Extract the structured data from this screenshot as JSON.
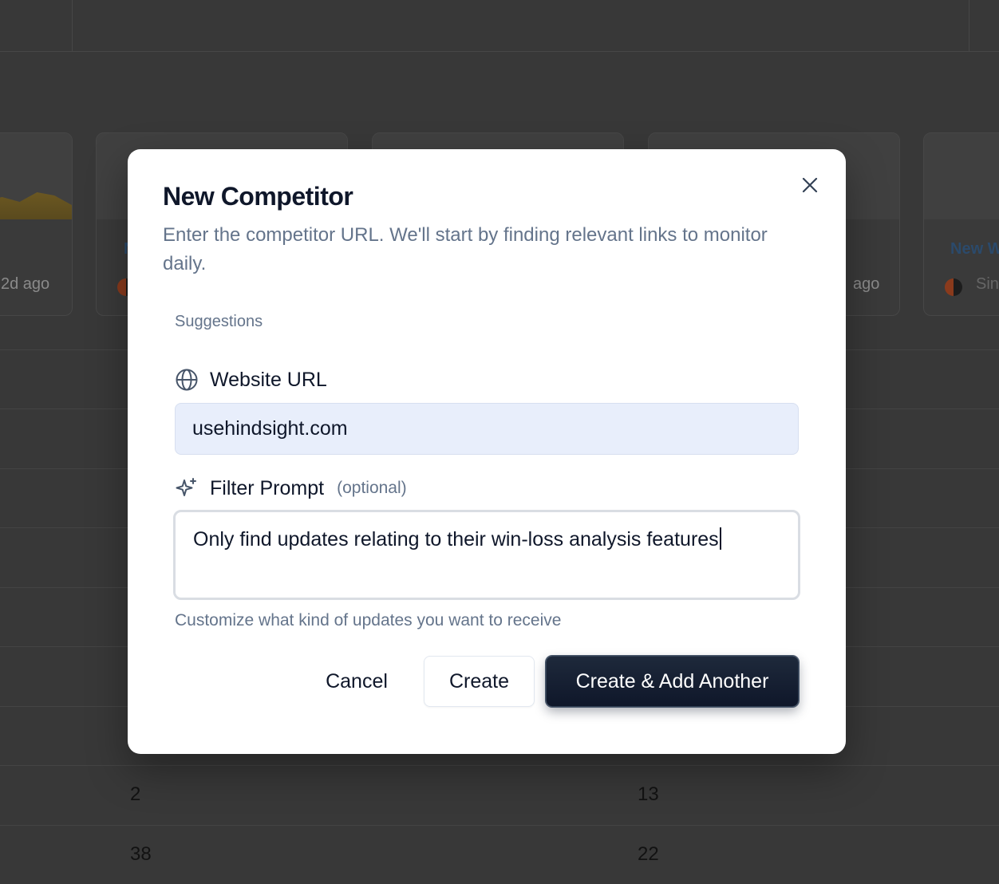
{
  "background": {
    "cards": [
      {
        "time": "2d ago",
        "new_label": "",
        "source": ""
      },
      {
        "time": "",
        "new_label": "N",
        "source": ""
      },
      {
        "time": "",
        "new_label": "",
        "source": ""
      },
      {
        "time": "ago",
        "new_label": "",
        "source": ""
      },
      {
        "time": "",
        "new_label": "New W",
        "source": "Sin"
      }
    ],
    "table_rows": [
      {
        "col1": "2",
        "col2": "13"
      },
      {
        "col1": "38",
        "col2": "22"
      }
    ]
  },
  "modal": {
    "title": "New Competitor",
    "description": "Enter the competitor URL. We'll start by finding relevant links to monitor daily.",
    "suggestions_label": "Suggestions",
    "website_url": {
      "label": "Website URL",
      "value": "usehindsight.com"
    },
    "filter_prompt": {
      "label": "Filter Prompt",
      "optional_label": "(optional)",
      "value": "Only find updates relating to their win-loss analysis features",
      "helper": "Customize what kind of updates you want to receive"
    },
    "buttons": {
      "cancel": "Cancel",
      "create": "Create",
      "create_add_another": "Create & Add Another"
    }
  },
  "colors": {
    "primary_button": "#0f172a",
    "input_filled_bg": "#e8eefb",
    "muted_text": "#64748b"
  }
}
